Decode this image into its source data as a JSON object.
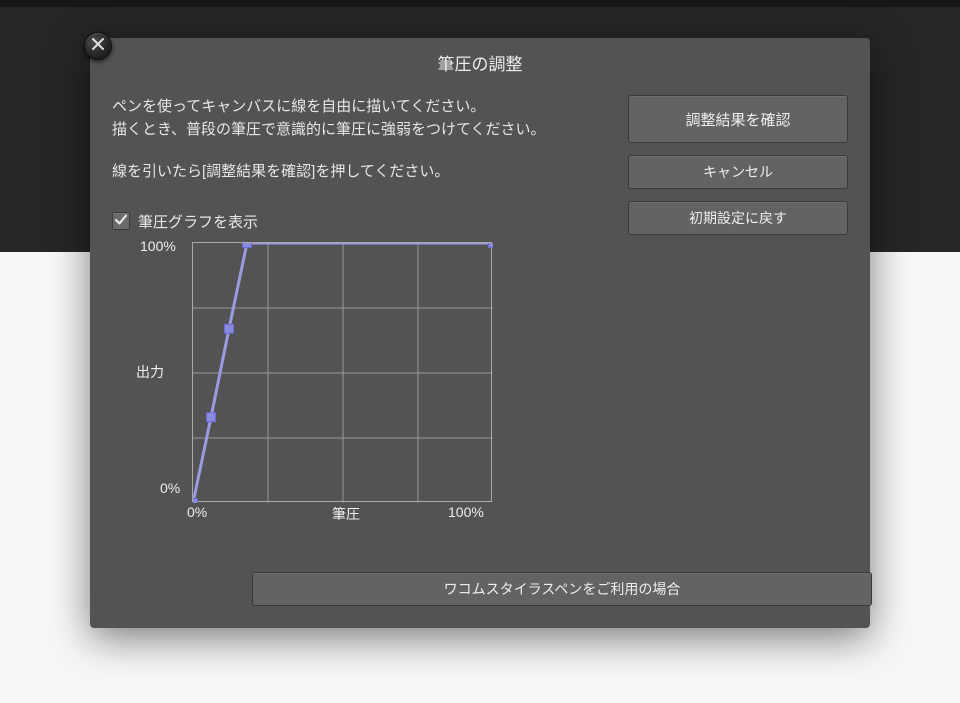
{
  "dialog": {
    "title": "筆圧の調整",
    "close_icon": "close",
    "instructions": {
      "line1": "ペンを使ってキャンバスに線を自由に描いてください。",
      "line2": "描くとき、普段の筆圧で意識的に筆圧に強弱をつけてください。",
      "line3": "線を引いたら[調整結果を確認]を押してください。"
    },
    "checkbox": {
      "label": "筆圧グラフを表示",
      "checked": true
    },
    "buttons": {
      "confirm": "調整結果を確認",
      "cancel": "キャンセル",
      "reset": "初期設定に戻す",
      "wacom": "ワコムスタイラスペンをご利用の場合"
    },
    "graph": {
      "y_max": "100%",
      "y_min": "0%",
      "y_label": "出力",
      "x_min": "0%",
      "x_max": "100%",
      "x_label": "筆圧"
    }
  },
  "chart_data": {
    "type": "line",
    "title": "筆圧の調整",
    "xlabel": "筆圧",
    "ylabel": "出力",
    "xlim": [
      0,
      100
    ],
    "ylim": [
      0,
      100
    ],
    "control_points": [
      {
        "x": 0,
        "y": 0
      },
      {
        "x": 6,
        "y": 33
      },
      {
        "x": 12,
        "y": 67
      },
      {
        "x": 18,
        "y": 100
      },
      {
        "x": 100,
        "y": 100
      }
    ],
    "curve_color": "#9b9ce0",
    "handle_color": "#8a8ae0",
    "grid": true
  }
}
